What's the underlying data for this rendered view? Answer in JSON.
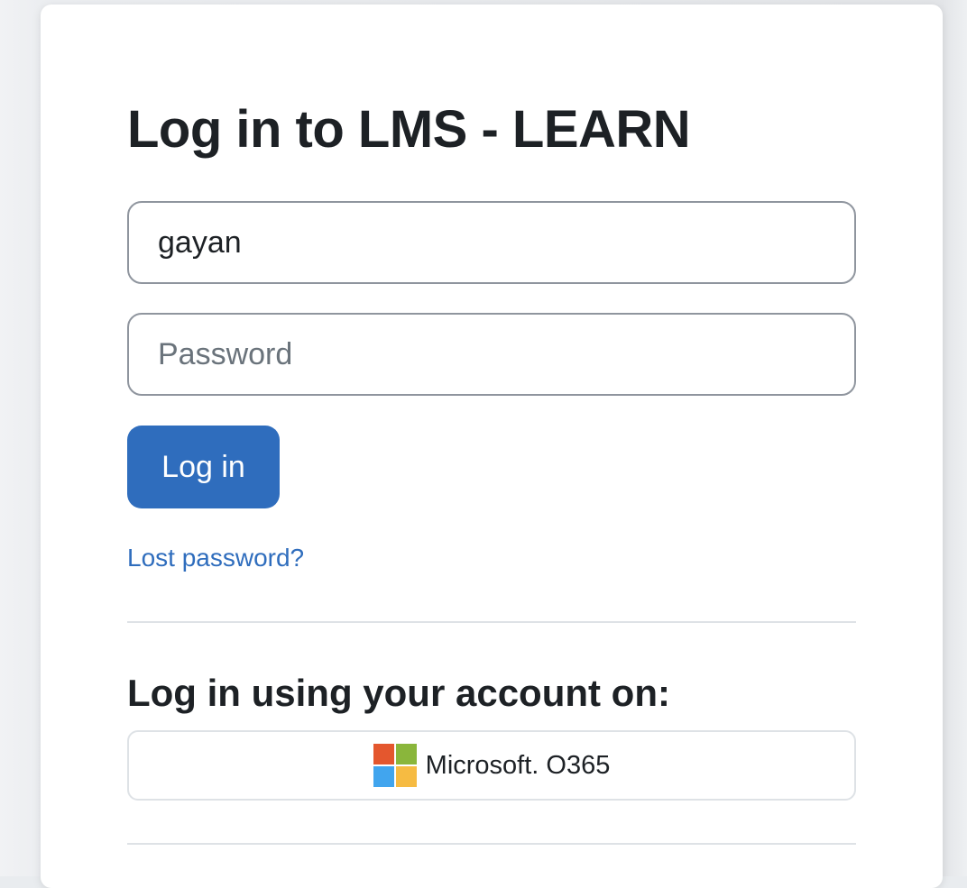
{
  "login": {
    "title": "Log in to LMS - LEARN",
    "username_value": "gayan",
    "password_placeholder": "Password",
    "login_button_label": "Log in",
    "lost_password_label": "Lost password?"
  },
  "identity_providers": {
    "heading": "Log in using your account on:",
    "items": [
      {
        "label": "Microsoft. O365",
        "icon": "microsoft-logo-icon",
        "logo_colors": [
          "#f25022",
          "#7fba00",
          "#00a4ef",
          "#ffb900"
        ]
      }
    ]
  },
  "colors": {
    "accent": "#2f6dbd",
    "text": "#1d2125",
    "input_border": "#8f959e"
  }
}
